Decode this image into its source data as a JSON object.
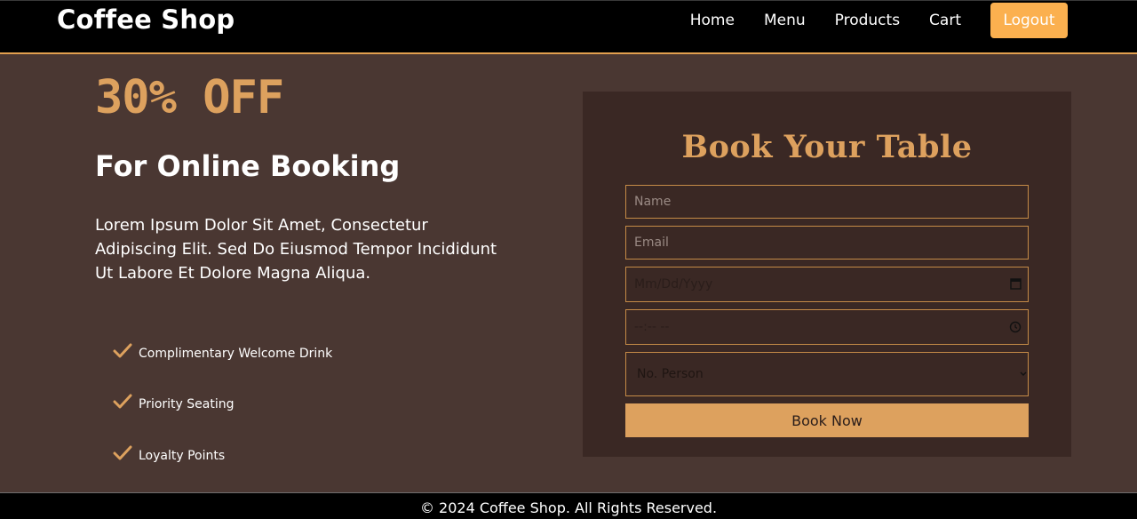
{
  "header": {
    "brand": "Coffee Shop",
    "nav": [
      "Home",
      "Menu",
      "Products",
      "Cart"
    ],
    "logout_label": "Logout"
  },
  "hero": {
    "discount": "30% OFF",
    "subhead": "For Online Booking",
    "description": "Lorem Ipsum Dolor Sit Amet, Consectetur Adipiscing Elit. Sed Do Eiusmod Tempor Incididunt Ut Labore Et Dolore Magna Aliqua.",
    "features": [
      "Complimentary Welcome Drink",
      "Priority Seating",
      "Loyalty Points"
    ]
  },
  "booking_form": {
    "title": "Book Your Table",
    "name_placeholder": "Name",
    "email_placeholder": "Email",
    "date_placeholder": "Mm/Dd/Yyyy",
    "time_placeholder": "--:-- --",
    "person_selected": "No. Person",
    "submit_label": "Book Now"
  },
  "footer": {
    "copyright": "© 2024 Coffee Shop. All Rights Reserved."
  },
  "colors": {
    "accent": "#dda15e",
    "logout_bg": "#fbb04f",
    "page_bg": "#4a3732",
    "panel_bg": "#3a2824"
  }
}
